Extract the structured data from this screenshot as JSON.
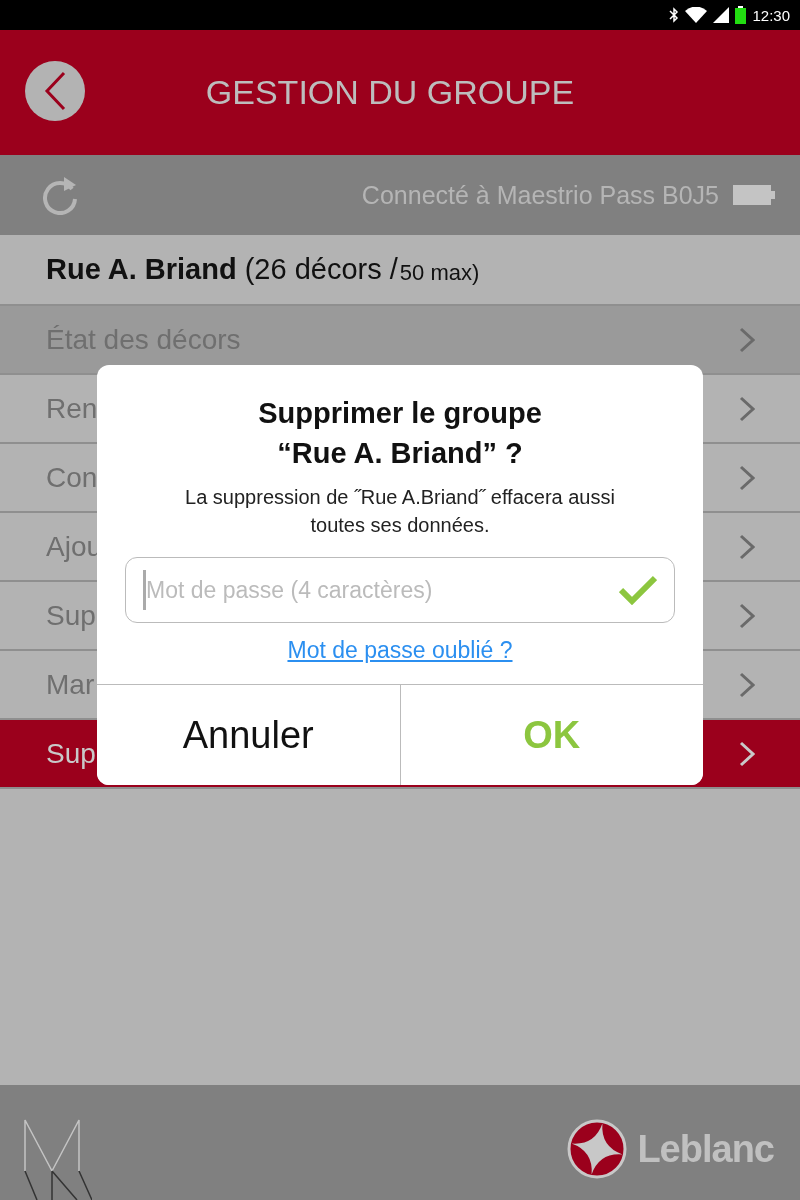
{
  "status_bar": {
    "time": "12:30"
  },
  "header": {
    "title": "GESTION DU GROUPE"
  },
  "connection": {
    "text": "Connecté à Maestrio Pass B0J5"
  },
  "group": {
    "name": "Rue A. Briand",
    "count": "(26 décors /",
    "max": "50 max)"
  },
  "menu": [
    {
      "label": "État des décors",
      "highlighted": true,
      "selected": false
    },
    {
      "label": "Ren",
      "highlighted": false,
      "selected": false
    },
    {
      "label": "Con",
      "highlighted": false,
      "selected": false
    },
    {
      "label": "Ajou",
      "highlighted": false,
      "selected": false
    },
    {
      "label": "Sup",
      "highlighted": false,
      "selected": false
    },
    {
      "label": "Mar",
      "highlighted": false,
      "selected": false
    },
    {
      "label": "Sup",
      "highlighted": false,
      "selected": true
    }
  ],
  "dialog": {
    "title_line_1": "Supprimer le groupe",
    "title_line_2": "“Rue A. Briand” ?",
    "message": "La suppression de ˝Rue A.Briand˝ effacera aussi toutes ses données.",
    "password": {
      "placeholder": "Mot de passe (4 caractères)"
    },
    "link": "Mot de passe oublié ?",
    "buttons": [
      "Annuler",
      "OK"
    ]
  },
  "footer": {
    "brand": "Leblanc"
  }
}
